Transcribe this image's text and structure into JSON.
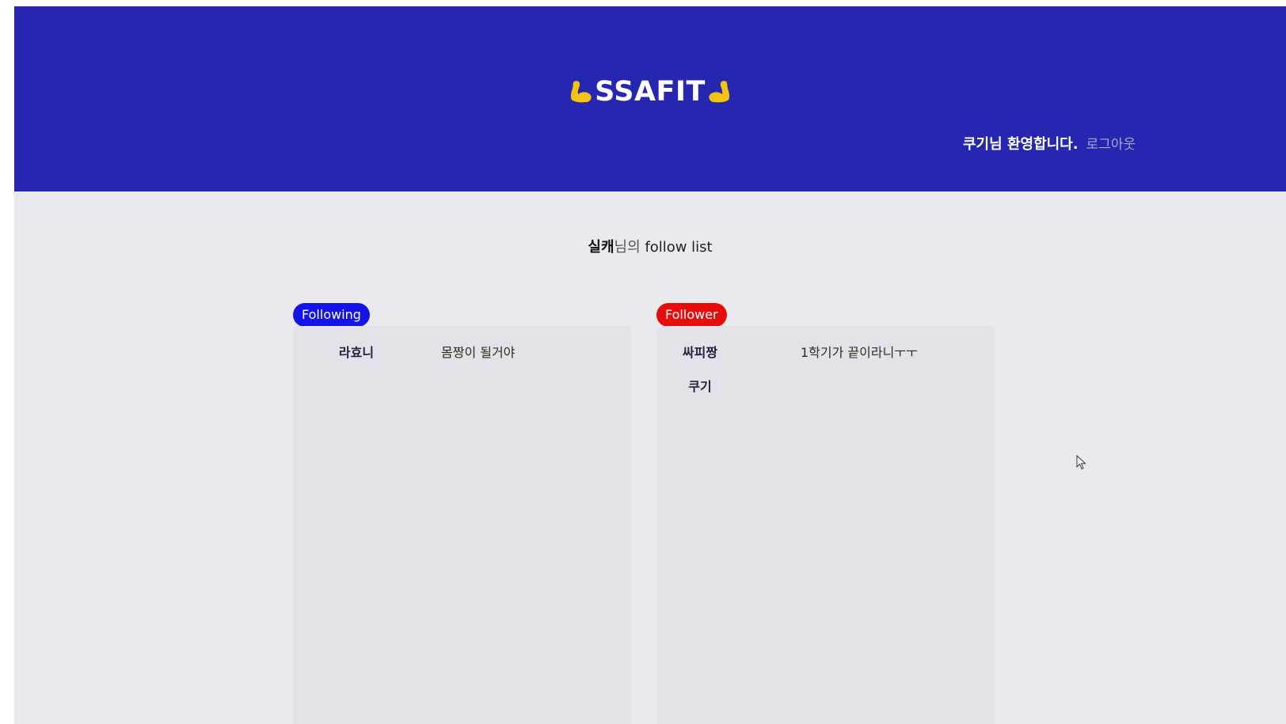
{
  "header": {
    "logo_text": "SSAFIT",
    "logo_icon": "flexed-biceps-icon",
    "welcome_text": "쿠기님 환영합니다.",
    "logout_label": "로그아웃"
  },
  "page": {
    "owner": "실캐",
    "suffix_ko": "님의",
    "suffix_en": " follow list"
  },
  "following": {
    "label": "Following",
    "items": [
      {
        "name": "라효니",
        "bio": "몸짱이 될거야"
      }
    ]
  },
  "follower": {
    "label": "Follower",
    "items": [
      {
        "name": "싸피짱",
        "bio": "1학기가 끝이라니ㅜㅜ"
      },
      {
        "name": "쿠기",
        "bio": ""
      }
    ]
  },
  "colors": {
    "header_bg": "#2626b0",
    "page_bg": "#eae9ed",
    "panel_bg": "#e2e2e8",
    "following_badge": "#1414e8",
    "follower_badge": "#e60d0d",
    "logo_icon": "#f2c40f"
  }
}
